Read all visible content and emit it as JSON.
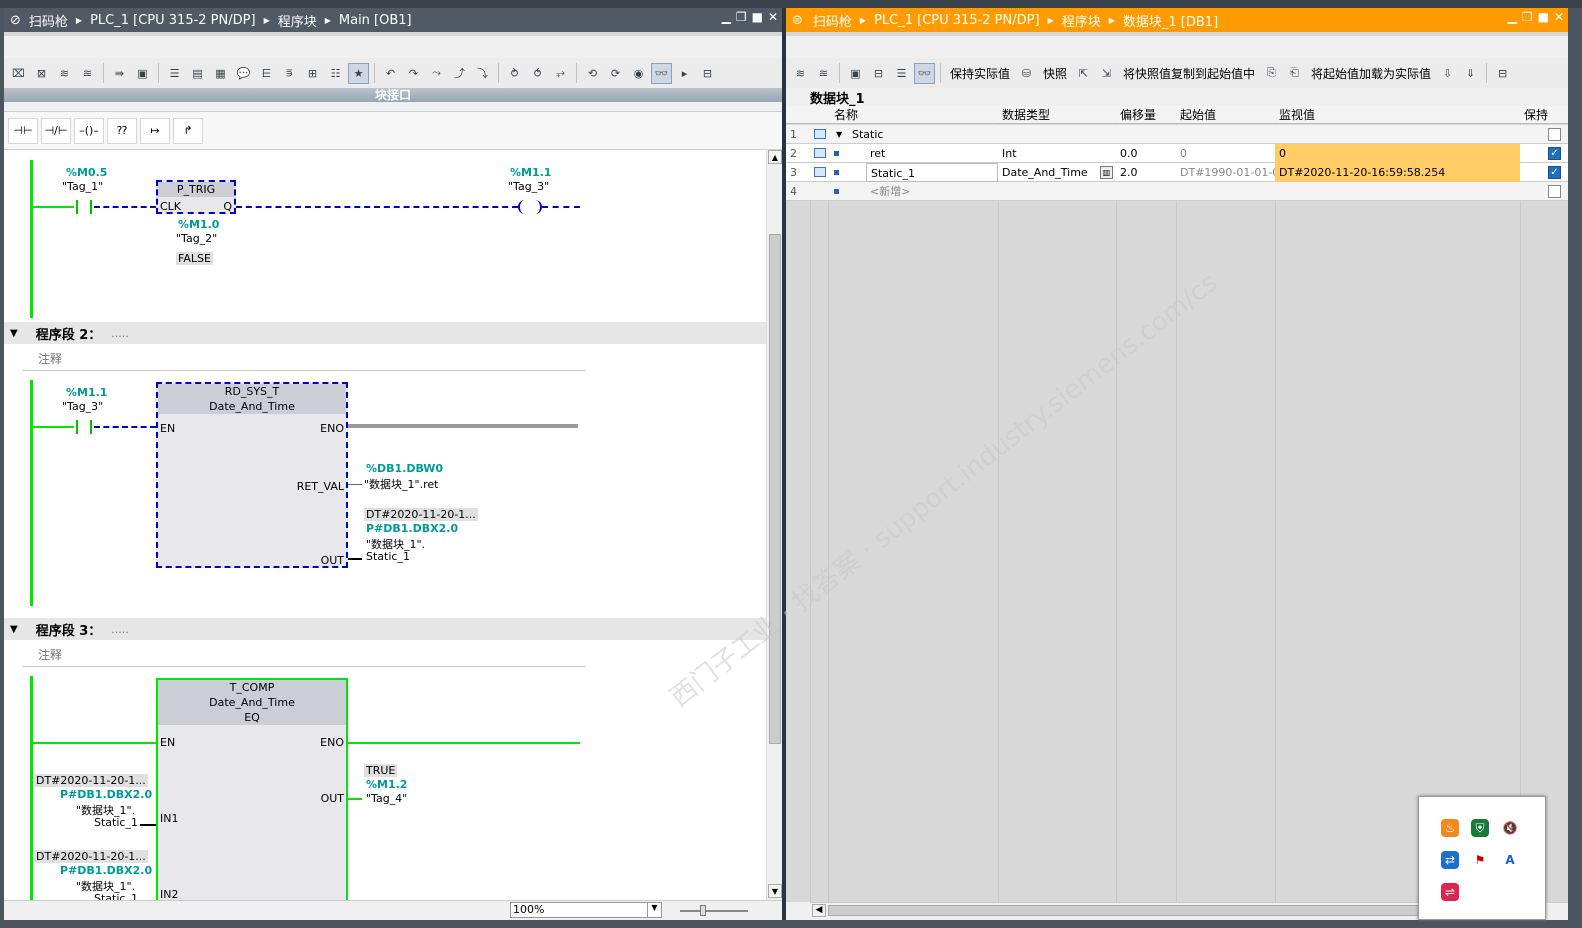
{
  "left_pane": {
    "breadcrumb": [
      "扫码枪",
      "PLC_1 [CPU 315-2 PN/DP]",
      "程序块",
      "Main [OB1]"
    ],
    "interface_label": "块接口",
    "ladder_buttons": [
      "⊣⊢",
      "⊣/⊢",
      "–()–",
      "⁇",
      "↦",
      "↱"
    ],
    "network1": {
      "contact1_addr": "%M0.5",
      "contact1_tag": "\"Tag_1\"",
      "block": "P_TRIG",
      "pin_clk": "CLK",
      "pin_q": "Q",
      "below_addr": "%M1.0",
      "below_tag": "\"Tag_2\"",
      "below_state": "FALSE",
      "coil_addr": "%M1.1",
      "coil_tag": "\"Tag_3\""
    },
    "network2": {
      "title": "程序段 2：",
      "dots": ".....",
      "comment": "注释",
      "contact_addr": "%M1.1",
      "contact_tag": "\"Tag_3\"",
      "block": "RD_SYS_T",
      "block_type": "Date_And_Time",
      "pin_en": "EN",
      "pin_eno": "ENO",
      "pin_ret": "RET_VAL",
      "pin_out": "OUT",
      "ret_addr": "%DB1.DBW0",
      "ret_tag": "\"数据块_1\".ret",
      "out_value": "DT#2020-11-20-1...",
      "out_addr": "P#DB1.DBX2.0",
      "out_tag1": "\"数据块_1\".",
      "out_tag2": "Static_1"
    },
    "network3": {
      "title": "程序段 3：",
      "dots": ".....",
      "comment": "注释",
      "block": "T_COMP",
      "block_type": "Date_And_Time",
      "block_op": "EQ",
      "pin_en": "EN",
      "pin_eno": "ENO",
      "pin_out": "OUT",
      "pin_in1": "IN1",
      "pin_in2": "IN2",
      "out_state": "TRUE",
      "out_addr": "%M1.2",
      "out_tag": "\"Tag_4\"",
      "in1_value": "DT#2020-11-20-1...",
      "in1_addr": "P#DB1.DBX2.0",
      "in1_tag1": "\"数据块_1\".",
      "in1_tag2": "Static_1",
      "in2_value": "DT#2020-11-20-1...",
      "in2_addr": "P#DB1.DBX2.0",
      "in2_tag1": "\"数据块_1\".",
      "in2_tag2": "Static_1"
    },
    "zoom": "100%"
  },
  "right_pane": {
    "breadcrumb": [
      "扫码枪",
      "PLC_1 [CPU 315-2 PN/DP]",
      "程序块",
      "数据块_1 [DB1]"
    ],
    "toolbar": {
      "keep_actual": "保持实际值",
      "snapshot": "快照",
      "copy_snapshot": "将快照值复制到起始值中",
      "load_start": "将起始值加载为实际值"
    },
    "db_title": "数据块_1",
    "columns": [
      "名称",
      "数据类型",
      "偏移量",
      "起始值",
      "监视值",
      "保持"
    ],
    "rows": [
      {
        "num": "1",
        "name": "Static",
        "type": "",
        "offset": "",
        "start": "",
        "monitor": "",
        "retain": false
      },
      {
        "num": "2",
        "name": "ret",
        "type": "Int",
        "offset": "0.0",
        "start": "0",
        "monitor": "0",
        "retain": true
      },
      {
        "num": "3",
        "name": "Static_1",
        "type": "Date_And_Time",
        "offset": "2.0",
        "start": "DT#1990-01-01-0",
        "monitor": "DT#2020-11-20-16:59:58.254",
        "retain": true
      },
      {
        "num": "4",
        "name": "<新增>",
        "type": "",
        "offset": "",
        "start": "",
        "monitor": "",
        "retain": false
      }
    ]
  },
  "watermark": "西门子工业 · 找答案 · support.industry.siemens.com/cs",
  "colors": {
    "accent_orange": "#ff9b00",
    "rail_green": "#00e600",
    "monitor_highlight": "#ffcc66",
    "address_teal": "#009a9a"
  }
}
